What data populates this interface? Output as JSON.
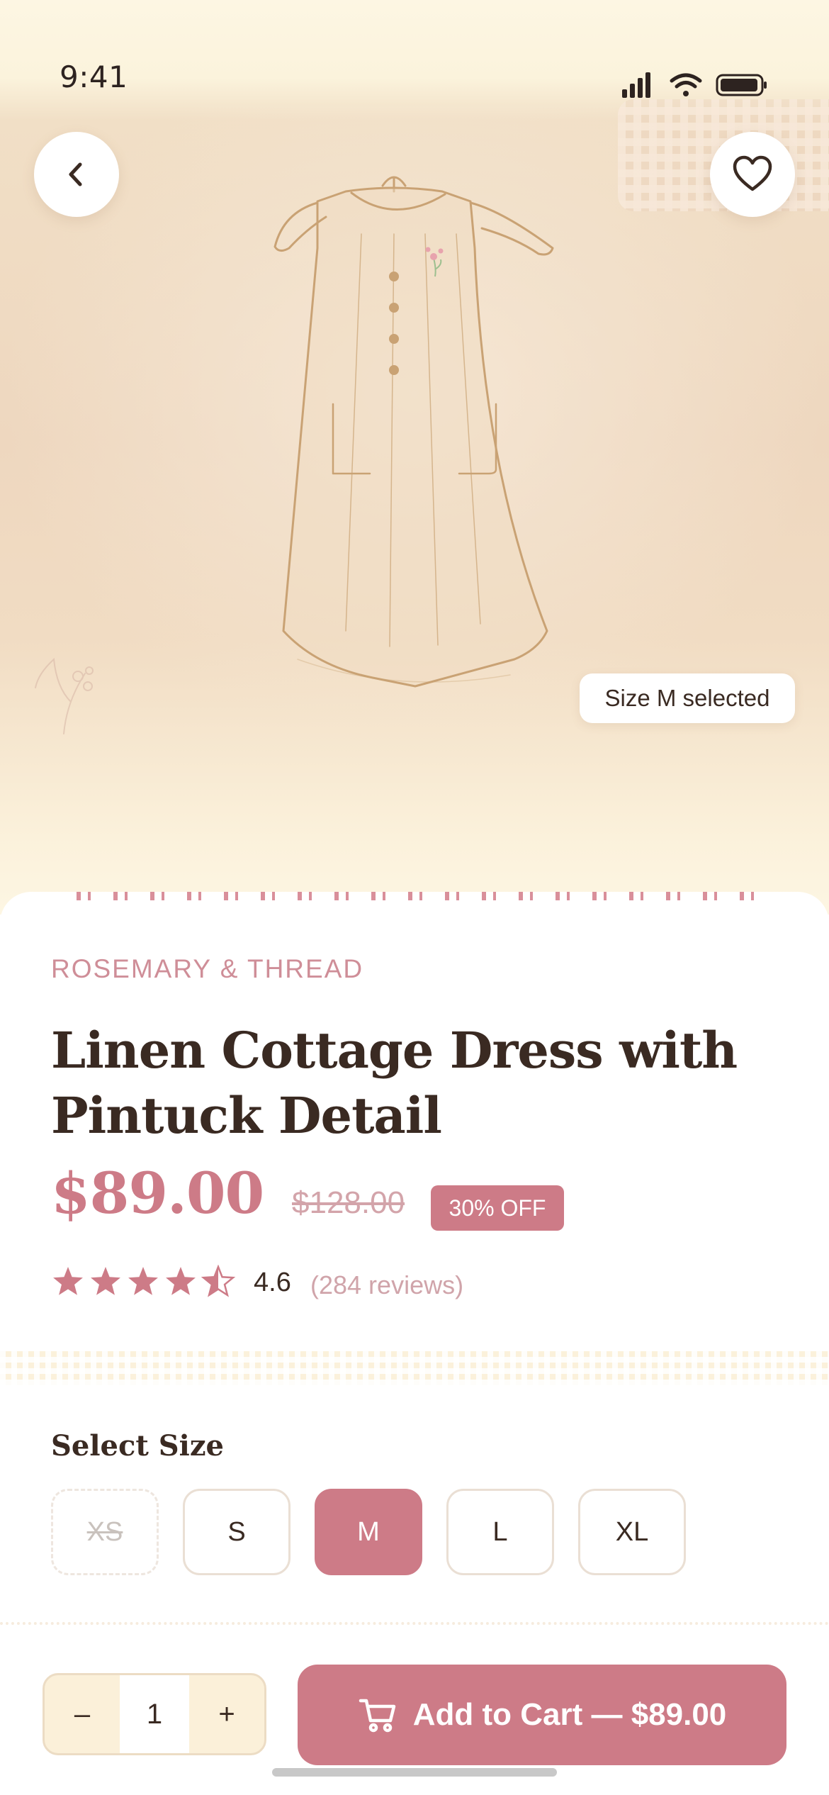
{
  "status_bar": {
    "time": "9:41"
  },
  "header": {
    "back_icon": "chevron-left-icon",
    "favorite_icon": "heart-outline-icon"
  },
  "hero": {
    "image_icon": "dress-illustration",
    "size_badge": "Size M selected"
  },
  "product": {
    "brand": "ROSEMARY & THREAD",
    "title": "Linen Cottage Dress with Pintuck Detail",
    "price": "$89.00",
    "original_price": "$128.00",
    "discount": "30% OFF",
    "rating": "4.6",
    "rating_value": 4.6,
    "reviews": "(284 reviews)"
  },
  "sizes": {
    "heading": "Select Size",
    "options": [
      {
        "label": "XS",
        "state": "unavailable"
      },
      {
        "label": "S",
        "state": "available"
      },
      {
        "label": "M",
        "state": "selected"
      },
      {
        "label": "L",
        "state": "available"
      },
      {
        "label": "XL",
        "state": "available"
      }
    ]
  },
  "cart": {
    "minus": "–",
    "quantity": "1",
    "plus": "+",
    "add_label": "Add to Cart — $89.00",
    "cart_icon": "cart-icon"
  },
  "colors": {
    "accent": "#cd7b87",
    "brand_text": "#cf8e98",
    "cream": "#fbf0d9",
    "dress_outline": "#c9a274",
    "text_dark": "#3a2a22"
  }
}
